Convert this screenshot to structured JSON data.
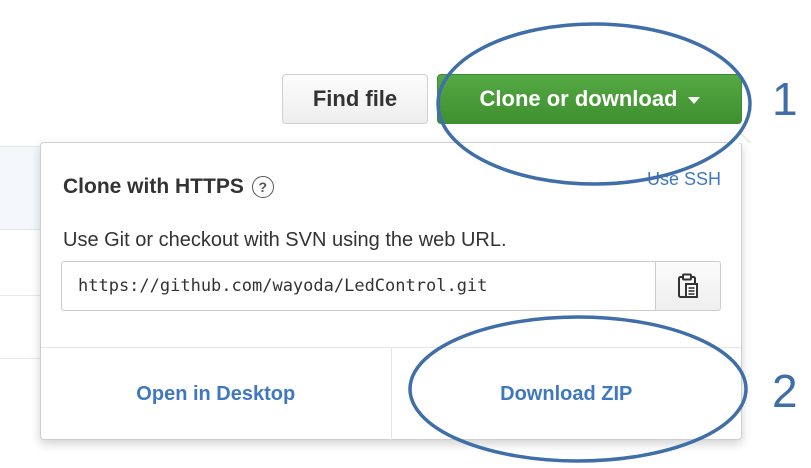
{
  "toolbar": {
    "find_file_label": "Find file",
    "clone_label": "Clone or download"
  },
  "clone_panel": {
    "title": "Clone with HTTPS",
    "help_symbol": "?",
    "use_ssh_label": "Use SSH",
    "instructions": "Use Git or checkout with SVN using the web URL.",
    "url_value": "https://github.com/wayoda/LedControl.git",
    "open_desktop_label": "Open in Desktop",
    "download_zip_label": "Download ZIP"
  },
  "annotations": {
    "step1": "1",
    "step2": "2"
  },
  "colors": {
    "clone_button": "#4c9f3d",
    "link_blue": "#4078c0",
    "annotation_blue": "#3f6ea8"
  },
  "icons": {
    "copy": "clipboard-icon",
    "help": "question-circle-icon",
    "dropdown": "caret-down-icon"
  }
}
